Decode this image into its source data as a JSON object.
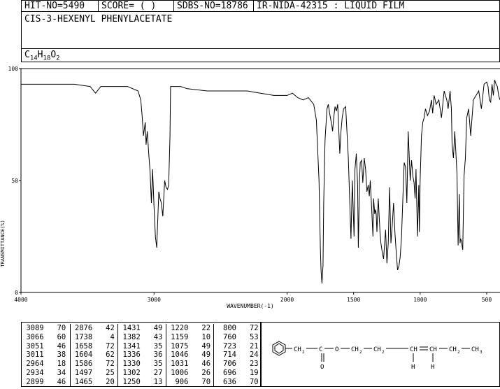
{
  "header": {
    "hit_no": "HIT-NO=5490",
    "score": "SCORE=  (   )",
    "sdbs_no": "SDBS-NO=18786",
    "ir_nida": "IR-NIDA-42315 : LIQUID FILM"
  },
  "compound": {
    "name": "CIS-3-HEXENYL PHENYLACETATE",
    "formula_parts": [
      {
        "t": "C",
        "sub": false
      },
      {
        "t": "14",
        "sub": true
      },
      {
        "t": "H",
        "sub": false
      },
      {
        "t": "18",
        "sub": true
      },
      {
        "t": "O",
        "sub": false
      },
      {
        "t": "2",
        "sub": true
      }
    ]
  },
  "chart_data": {
    "type": "line",
    "xlabel": "WAVENUMBER(-1)",
    "ylabel": "TRANSMITTANCE(%)",
    "xlim": [
      4000,
      400
    ],
    "ylim": [
      0,
      100
    ],
    "x_ticks": [
      4000,
      3000,
      2000,
      1500,
      1000,
      500
    ],
    "x_tick_labels": [
      "4000",
      "3000",
      "2000",
      "1500",
      "1000",
      "500"
    ],
    "y_ticks": [
      0,
      50,
      100
    ],
    "y_tick_labels": [
      "0",
      "50",
      "100"
    ],
    "grid": false,
    "legend": "none",
    "series": [
      {
        "x": [
          4000,
          3800,
          3600,
          3480,
          3440,
          3400,
          3300,
          3200,
          3120,
          3100,
          3090,
          3080,
          3066,
          3060,
          3051,
          3040,
          3030,
          3020,
          3011,
          3000,
          2990,
          2980,
          2964,
          2955,
          2945,
          2934,
          2920,
          2910,
          2899,
          2890,
          2880,
          2876,
          2860,
          2840,
          2820,
          2800,
          2750,
          2600,
          2400,
          2300,
          2200,
          2100,
          2000,
          1960,
          1920,
          1880,
          1840,
          1800,
          1780,
          1760,
          1750,
          1745,
          1738,
          1730,
          1725,
          1715,
          1700,
          1690,
          1680,
          1665,
          1658,
          1650,
          1640,
          1630,
          1620,
          1604,
          1595,
          1586,
          1575,
          1560,
          1540,
          1520,
          1510,
          1497,
          1490,
          1480,
          1470,
          1465,
          1455,
          1450,
          1440,
          1431,
          1420,
          1410,
          1400,
          1390,
          1382,
          1375,
          1365,
          1355,
          1350,
          1341,
          1335,
          1330,
          1325,
          1315,
          1302,
          1295,
          1285,
          1275,
          1260,
          1250,
          1240,
          1230,
          1220,
          1210,
          1200,
          1190,
          1180,
          1170,
          1159,
          1150,
          1140,
          1130,
          1120,
          1110,
          1100,
          1090,
          1075,
          1065,
          1055,
          1046,
          1038,
          1031,
          1020,
          1010,
          1006,
          1000,
          990,
          980,
          970,
          960,
          945,
          930,
          915,
          906,
          895,
          880,
          860,
          840,
          820,
          800,
          790,
          775,
          765,
          760,
          750,
          740,
          723,
          715,
          706,
          700,
          696,
          690,
          680,
          670,
          660,
          650,
          636,
          620,
          600,
          580,
          560,
          540,
          520,
          500,
          490,
          480,
          470,
          460,
          450,
          440,
          430,
          420,
          410,
          400
        ],
        "y": [
          93,
          93,
          93,
          92,
          89,
          92,
          92,
          92,
          90,
          86,
          79,
          70,
          76,
          66,
          72,
          62,
          54,
          40,
          55,
          38,
          25,
          20,
          45,
          42,
          40,
          34,
          50,
          47,
          46,
          48,
          70,
          92,
          92,
          92,
          92,
          92,
          91,
          90,
          90,
          90,
          89,
          88,
          88,
          89,
          87,
          86,
          87,
          84,
          77,
          50,
          20,
          10,
          4,
          12,
          40,
          68,
          82,
          84,
          80,
          75,
          72,
          78,
          83,
          81,
          84,
          62,
          72,
          78,
          82,
          83,
          60,
          24,
          50,
          25,
          55,
          62,
          48,
          20,
          52,
          58,
          59,
          49,
          60,
          55,
          45,
          48,
          43,
          50,
          38,
          25,
          42,
          35,
          37,
          35,
          27,
          42,
          27,
          22,
          18,
          15,
          28,
          13,
          22,
          47,
          22,
          30,
          40,
          27,
          18,
          10,
          12,
          16,
          25,
          42,
          58,
          56,
          40,
          72,
          50,
          59,
          52,
          49,
          42,
          55,
          25,
          48,
          27,
          50,
          70,
          76,
          78,
          82,
          79,
          81,
          86,
          80,
          88,
          84,
          86,
          78,
          90,
          86,
          82,
          90,
          82,
          66,
          60,
          72,
          53,
          21,
          44,
          22,
          24,
          23,
          19,
          52,
          60,
          78,
          82,
          70,
          86,
          88,
          90,
          82,
          93,
          94,
          92,
          86,
          85,
          93,
          88,
          95,
          93,
          92,
          88,
          86
        ]
      }
    ]
  },
  "peak_table": {
    "columns": [
      [
        [
          "3089",
          "70"
        ],
        [
          "3066",
          "60"
        ],
        [
          "3051",
          "46"
        ],
        [
          "3011",
          "38"
        ],
        [
          "2964",
          "18"
        ],
        [
          "2934",
          "34"
        ],
        [
          "2899",
          "46"
        ]
      ],
      [
        [
          "2876",
          "42"
        ],
        [
          "1738",
          "4"
        ],
        [
          "1658",
          "72"
        ],
        [
          "1604",
          "62"
        ],
        [
          "1586",
          "72"
        ],
        [
          "1497",
          "25"
        ],
        [
          "1465",
          "20"
        ]
      ],
      [
        [
          "1431",
          "49"
        ],
        [
          "1382",
          "43"
        ],
        [
          "1341",
          "35"
        ],
        [
          "1336",
          "36"
        ],
        [
          "1330",
          "35"
        ],
        [
          "1302",
          "27"
        ],
        [
          "1250",
          "13"
        ]
      ],
      [
        [
          "1220",
          "22"
        ],
        [
          "1159",
          "10"
        ],
        [
          "1075",
          "49"
        ],
        [
          "1046",
          "49"
        ],
        [
          "1031",
          "46"
        ],
        [
          "1006",
          "26"
        ],
        [
          "906",
          "70"
        ]
      ],
      [
        [
          "800",
          "72"
        ],
        [
          "760",
          "53"
        ],
        [
          "723",
          "21"
        ],
        [
          "714",
          "24"
        ],
        [
          "706",
          "23"
        ],
        [
          "696",
          "19"
        ],
        [
          "636",
          "70"
        ]
      ]
    ]
  },
  "structure_labels": {
    "ch2_a": "CH",
    "ch2_a_sub": "2",
    "c": "C",
    "o_ester": "O",
    "ch2_b": "CH",
    "ch2_b_sub": "2",
    "ch2_c": "CH",
    "ch2_c_sub": "2",
    "ch_a": "CH",
    "ch_b": "CH",
    "ch2_d": "CH",
    "ch2_d_sub": "2",
    "ch3": "CH",
    "ch3_sub": "3",
    "o_carbonyl": "O",
    "h_a": "H",
    "h_b": "H"
  }
}
